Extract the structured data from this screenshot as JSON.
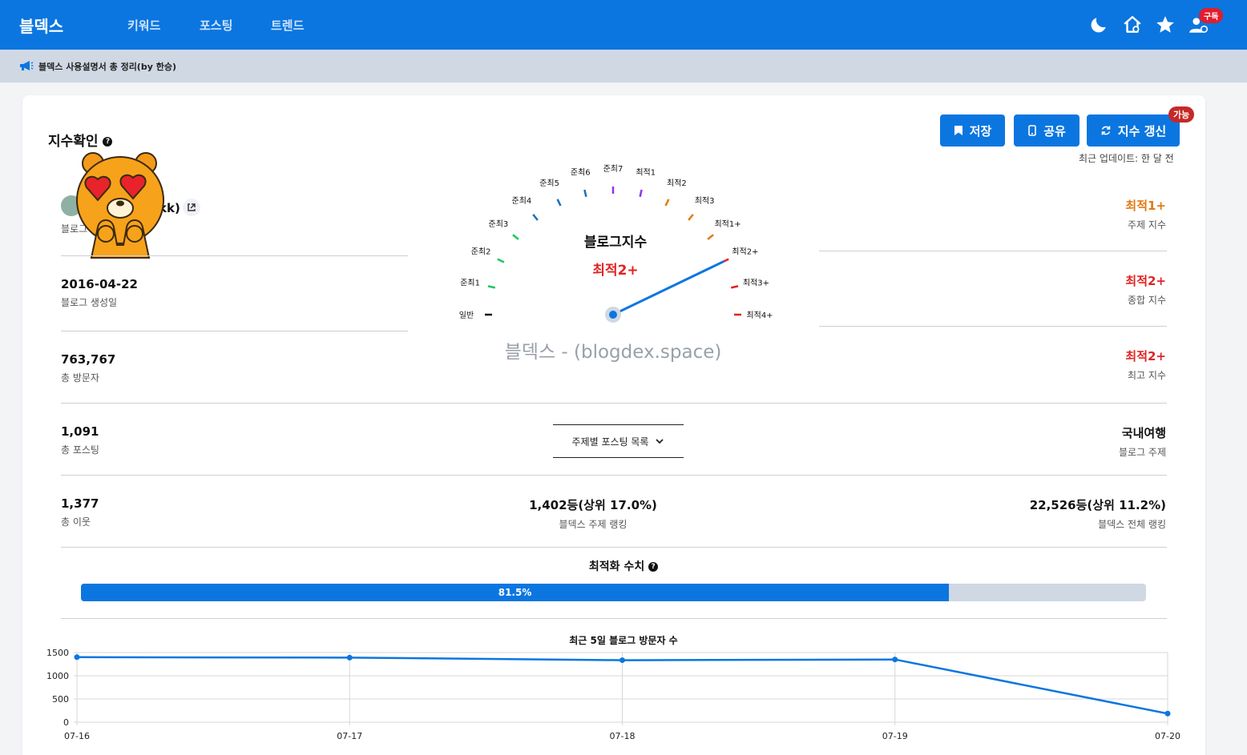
{
  "header": {
    "logo": "블덱스",
    "nav": [
      "키워드",
      "포스팅",
      "트렌드"
    ],
    "subscribe_badge": "구독"
  },
  "notice": {
    "text": "블덱스 사용설명서 총 정리(by 한승)"
  },
  "index_section": {
    "title": "지수확인",
    "buttons": {
      "save": "저장",
      "share": "공유",
      "refresh": "지수 갱신"
    },
    "refresh_badge": "가능",
    "updated": "최근 업데이트: 한 달 전"
  },
  "blog": {
    "name_partial": "kk)",
    "name_label_partial": "블로그"
  },
  "stats": [
    {
      "value": "2016-04-22",
      "label": "블로그 생성일"
    },
    {
      "value": "763,767",
      "label": "총 방문자"
    },
    {
      "value": "1,091",
      "label": "총 포스팅"
    },
    {
      "value": "1,377",
      "label": "총 이웃"
    }
  ],
  "right_stats": [
    {
      "value": "최적1+",
      "label": "주제 지수",
      "color": "#e07b15"
    },
    {
      "value": "최적2+",
      "label": "종합 지수",
      "color": "#e02424"
    },
    {
      "value": "최적2+",
      "label": "최고 지수",
      "color": "#e02424"
    },
    {
      "value": "국내여행",
      "label": "블로그 주제",
      "color": "#111111"
    },
    {
      "value": "22,526등(상위 11.2%)",
      "label": "블덱스 전체 랭킹",
      "color": "#111111"
    }
  ],
  "topic_ranking": {
    "value": "1,402등(상위 17.0%)",
    "label": "블덱스 주제 랭킹"
  },
  "dropdown": {
    "label": "주제별 포스팅 목록"
  },
  "gauge": {
    "title": "블로그지수",
    "value": "최적2+",
    "watermark": "블덱스 - (blogdex.space)",
    "levels": [
      "일반",
      "준최1",
      "준최2",
      "준최3",
      "준최4",
      "준최5",
      "준최6",
      "준최7",
      "최적1",
      "최적2",
      "최적3",
      "최적1+",
      "최적2+",
      "최적3+",
      "최적4+"
    ],
    "level_colors": [
      "#111111",
      "#22c55e",
      "#22c55e",
      "#22c55e",
      "#1e6fb8",
      "#1e6fb8",
      "#1e6fb8",
      "#9333ea",
      "#9333ea",
      "#e07b15",
      "#e07b15",
      "#e07b15",
      "#e02424",
      "#e02424",
      "#e02424"
    ],
    "current_level_index": 12
  },
  "optimization": {
    "title": "최적화 수치",
    "percent": 81.5,
    "label": "81.5%"
  },
  "chart_data": {
    "type": "line",
    "title": "최근 5일 블로그 방문자 수",
    "categories": [
      "07-16",
      "07-17",
      "07-18",
      "07-19",
      "07-20"
    ],
    "series": [
      {
        "values": [
          1400,
          1390,
          1335,
          1350,
          185
        ],
        "color": "#0b76e0"
      }
    ],
    "yticks": [
      "0",
      "500",
      "1000",
      "1500"
    ],
    "ylim": [
      0,
      1500
    ],
    "grid": true
  }
}
